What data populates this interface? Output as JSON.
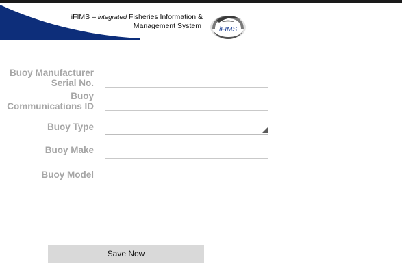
{
  "header": {
    "app_prefix": "iFIMS – ",
    "app_tagline_italic": "integrated",
    "title_line1_rest": " Fisheries Information &",
    "title_line2": "Management System",
    "logo_text": "iFIMS",
    "colors": {
      "swoosh": "#0d2e7a",
      "top_bar": "#1a1a1a"
    }
  },
  "form": {
    "fields": [
      {
        "label_line1": "Buoy Manufacturer",
        "label_line2": "Serial No.",
        "value": ""
      },
      {
        "label_line1": "Buoy",
        "label_line2": "Communications ID",
        "value": ""
      },
      {
        "label": "Buoy Type",
        "value": ""
      },
      {
        "label": "Buoy Make",
        "value": ""
      },
      {
        "label": "Buoy Model",
        "value": ""
      }
    ],
    "label_color": "#a6a6a6"
  },
  "actions": {
    "save_label": "Save Now"
  }
}
